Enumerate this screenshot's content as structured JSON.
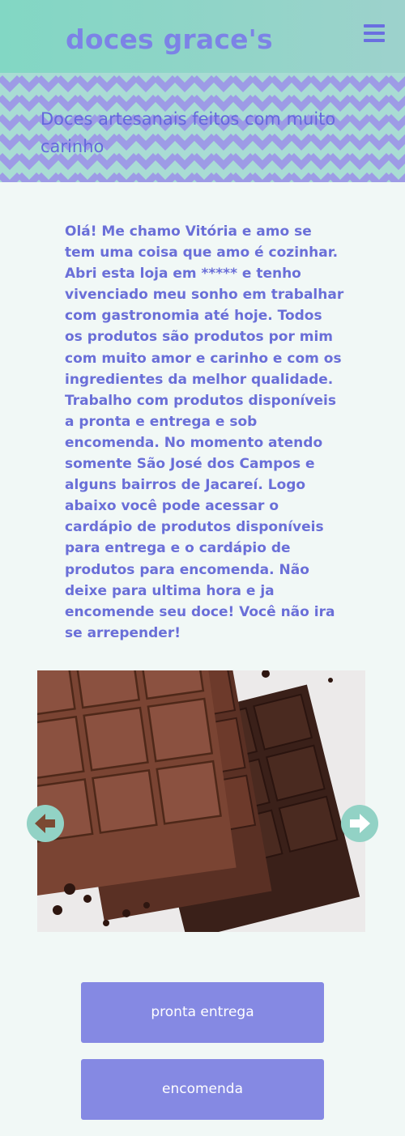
{
  "header": {
    "brand": "doces grace's",
    "menu_icon": "hamburger-menu-icon"
  },
  "banner": {
    "tagline": "Doces artesanais feitos com muito carinho"
  },
  "intro": {
    "text": "Olá! Me chamo Vitória e amo se tem uma coisa que amo é cozinhar. Abri esta loja em ***** e tenho vivenciado meu sonho em trabalhar com gastronomia até hoje. Todos os produtos são produtos por mim com muito amor e carinho e com os ingredientes da melhor qualidade. Trabalho com produtos disponíveis a pronta e entrega e sob encomenda. No momento atendo somente São José dos Campos e alguns bairros de Jacareí. Logo abaixo você pode acessar o cardápio de produtos disponíveis para entrega e o cardápio de produtos para encomenda. Não deixe para ultima hora e ja encomende seu doce! Você não ira se arrepender!"
  },
  "carousel": {
    "prev_icon": "arrow-left-icon",
    "next_icon": "arrow-right-icon"
  },
  "buttons": {
    "pronta": "pronta entrega",
    "encomenda": "encomenda"
  },
  "colors": {
    "brand": "#7c83e6",
    "header": "#8fd5c6",
    "button": "#8589e3",
    "background": "#f1f8f6"
  }
}
